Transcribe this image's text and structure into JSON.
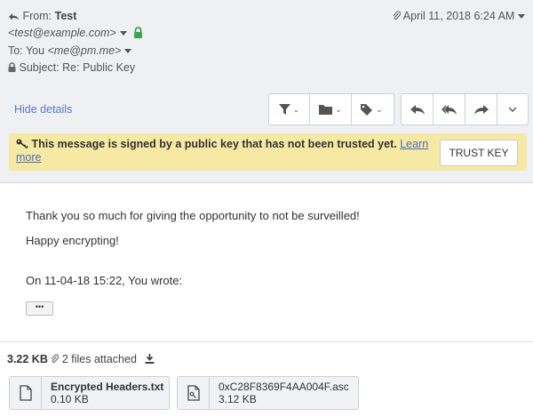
{
  "header": {
    "from_label": "From:",
    "from_name": "Test",
    "from_email": "<test@example.com>",
    "to_label": "To:",
    "to_name": "You",
    "to_email": "<me@pm.me>",
    "subject_label": "Subject:",
    "subject": "Re: Public Key",
    "date": "April 11, 2018 6:24 AM",
    "hide_details": "Hide details"
  },
  "toolbar": {
    "filter_icon": "filter-icon",
    "folder_icon": "folder-icon",
    "label_icon": "tag-icon",
    "reply_icon": "reply-icon",
    "reply_all_icon": "reply-all-icon",
    "forward_icon": "forward-icon",
    "more_icon": "chevron-down-icon"
  },
  "warning": {
    "message": "This message is signed by a public key that has not been trusted yet.",
    "link": "Learn more",
    "button": "TRUST KEY",
    "color": "#f6e9a4"
  },
  "body": {
    "line1": "Thank you so much for giving the opportunity to not be surveilled!",
    "line2": "Happy encrypting!",
    "quote_intro": "On 11-04-18 15:22, You wrote:",
    "ellipsis": "•••"
  },
  "attachments": {
    "size": "3.22 KB",
    "count_text": "2 files attached",
    "files": [
      {
        "name": "Encrypted Headers.txt",
        "size": "0.10 KB",
        "icon": "file-icon"
      },
      {
        "name": "0xC28F8369F4AA004F.asc",
        "size": "3.12 KB",
        "icon": "file-key-icon"
      }
    ]
  },
  "colors": {
    "link": "#5b78c2",
    "header_bg": "#eef0f3",
    "lock_green": "#3aa54a"
  }
}
